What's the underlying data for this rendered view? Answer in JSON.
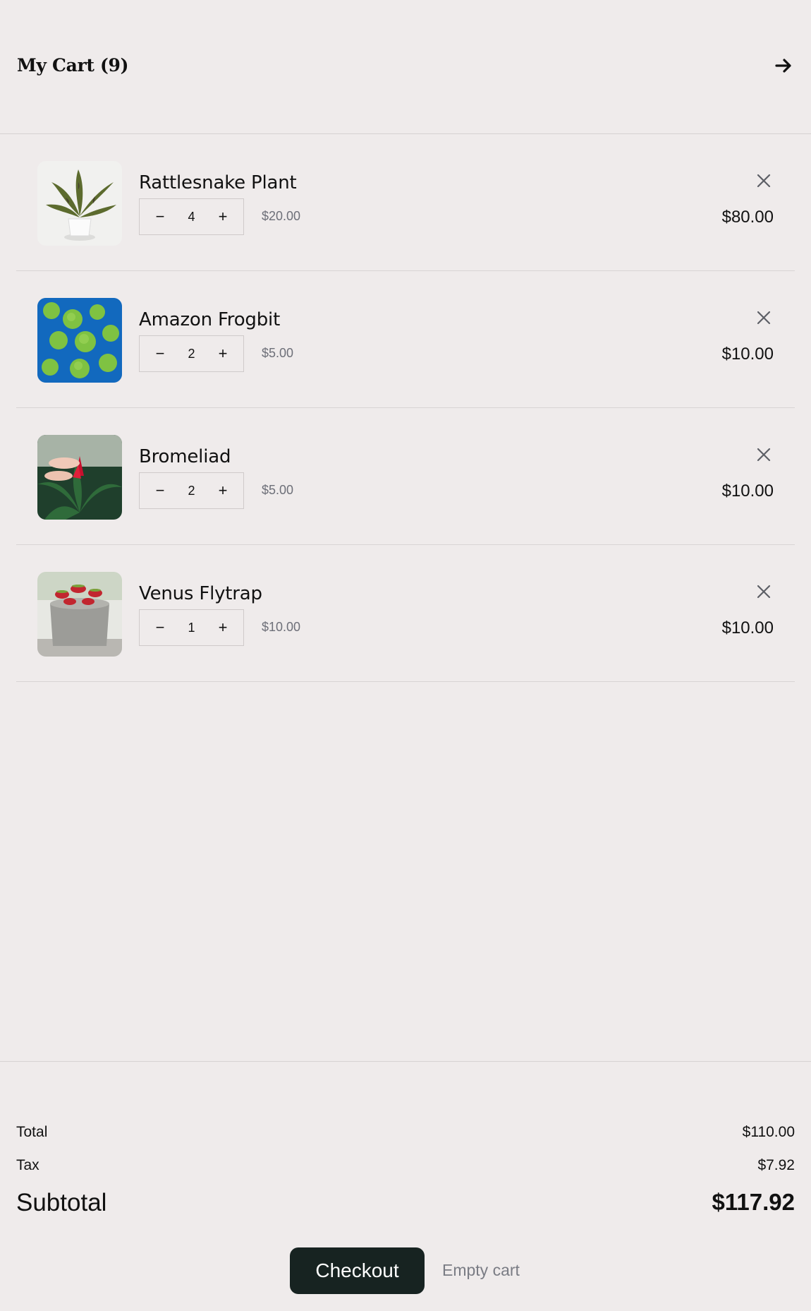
{
  "header": {
    "title": "My Cart (9)",
    "arrow_icon": "arrow-right-icon"
  },
  "items": [
    {
      "name": "Rattlesnake Plant",
      "quantity": "4",
      "unit_price": "$20.00",
      "line_total": "$80.00",
      "minus": "−",
      "plus": "+"
    },
    {
      "name": "Amazon Frogbit",
      "quantity": "2",
      "unit_price": "$5.00",
      "line_total": "$10.00",
      "minus": "−",
      "plus": "+"
    },
    {
      "name": "Bromeliad",
      "quantity": "2",
      "unit_price": "$5.00",
      "line_total": "$10.00",
      "minus": "−",
      "plus": "+"
    },
    {
      "name": "Venus Flytrap",
      "quantity": "1",
      "unit_price": "$10.00",
      "line_total": "$10.00",
      "minus": "−",
      "plus": "+"
    }
  ],
  "summary": {
    "total_label": "Total",
    "total_value": "$110.00",
    "tax_label": "Tax",
    "tax_value": "$7.92",
    "subtotal_label": "Subtotal",
    "subtotal_value": "$117.92"
  },
  "actions": {
    "checkout_label": "Checkout",
    "empty_cart_label": "Empty cart"
  },
  "colors": {
    "background": "#efebeb",
    "checkout_button": "#172321",
    "muted_text": "#6d6f78"
  }
}
